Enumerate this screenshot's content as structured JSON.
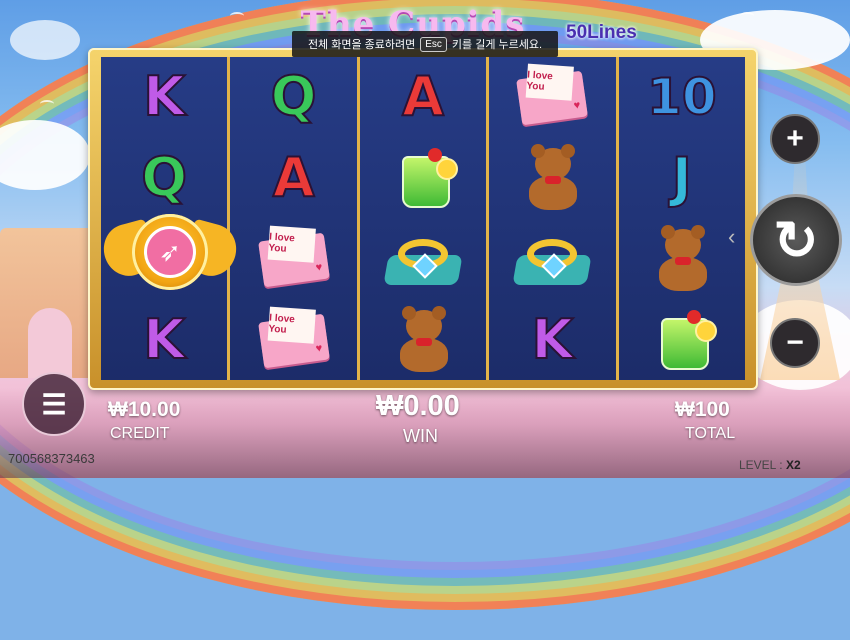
{
  "game": {
    "title_logo": "The Cupids",
    "lines": "50Lines"
  },
  "banner": {
    "prefix": "전체 화면을 종료하려면",
    "key": "Esc",
    "suffix": "키를 길게 누르세요."
  },
  "reels": [
    [
      "K",
      "Q",
      "wild-cupid",
      "K"
    ],
    [
      "Q",
      "A",
      "love-letter",
      "love-letter"
    ],
    [
      "A",
      "drink",
      "ring",
      "teddy-bear"
    ],
    [
      "love-letter",
      "teddy-bear",
      "ring",
      "K"
    ],
    [
      "10",
      "J",
      "teddy-bear",
      "drink"
    ]
  ],
  "symbols": {
    "love_letter_text": "I love You"
  },
  "credit": {
    "value": "₩10.00",
    "label": "CREDIT"
  },
  "win": {
    "value": "₩0.00",
    "label": "WIN"
  },
  "total": {
    "value": "₩100",
    "label": "TOTAL"
  },
  "player_id": "700568373463",
  "level": {
    "label": "LEVEL :",
    "value": "X2"
  },
  "controls": {
    "plus": "+",
    "minus": "−",
    "spin": "↻",
    "menu": "☰"
  }
}
